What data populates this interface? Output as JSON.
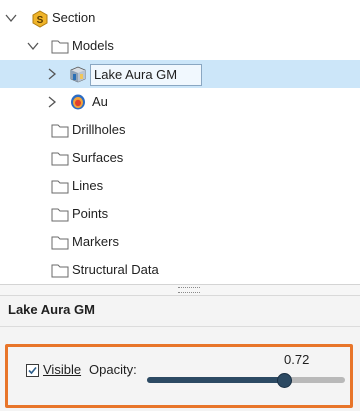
{
  "tree": {
    "items": [
      {
        "label": "Section",
        "icon": "section-icon",
        "chevron": "expanded"
      },
      {
        "label": "Models",
        "icon": "folder-icon",
        "chevron": "expanded"
      },
      {
        "label": "Lake Aura GM",
        "icon": "geological-model-icon",
        "chevron": "collapsed",
        "selected": true
      },
      {
        "label": "Au",
        "icon": "numeric-model-icon",
        "chevron": "collapsed"
      },
      {
        "label": "Drillholes",
        "icon": "folder-icon"
      },
      {
        "label": "Surfaces",
        "icon": "folder-icon"
      },
      {
        "label": "Lines",
        "icon": "folder-icon"
      },
      {
        "label": "Points",
        "icon": "folder-icon"
      },
      {
        "label": "Markers",
        "icon": "folder-icon"
      },
      {
        "label": "Structural Data",
        "icon": "folder-icon"
      }
    ]
  },
  "properties": {
    "title": "Lake Aura GM",
    "visible_label": "Visible",
    "visible_checked": true,
    "opacity_label": "Opacity:",
    "opacity_value": "0.72",
    "opacity": 0.72
  },
  "colors": {
    "selection": "#cce6f9",
    "highlight": "#e8752a",
    "slider_fill": "#2c4a63",
    "slider_track": "#b9b9b9"
  }
}
